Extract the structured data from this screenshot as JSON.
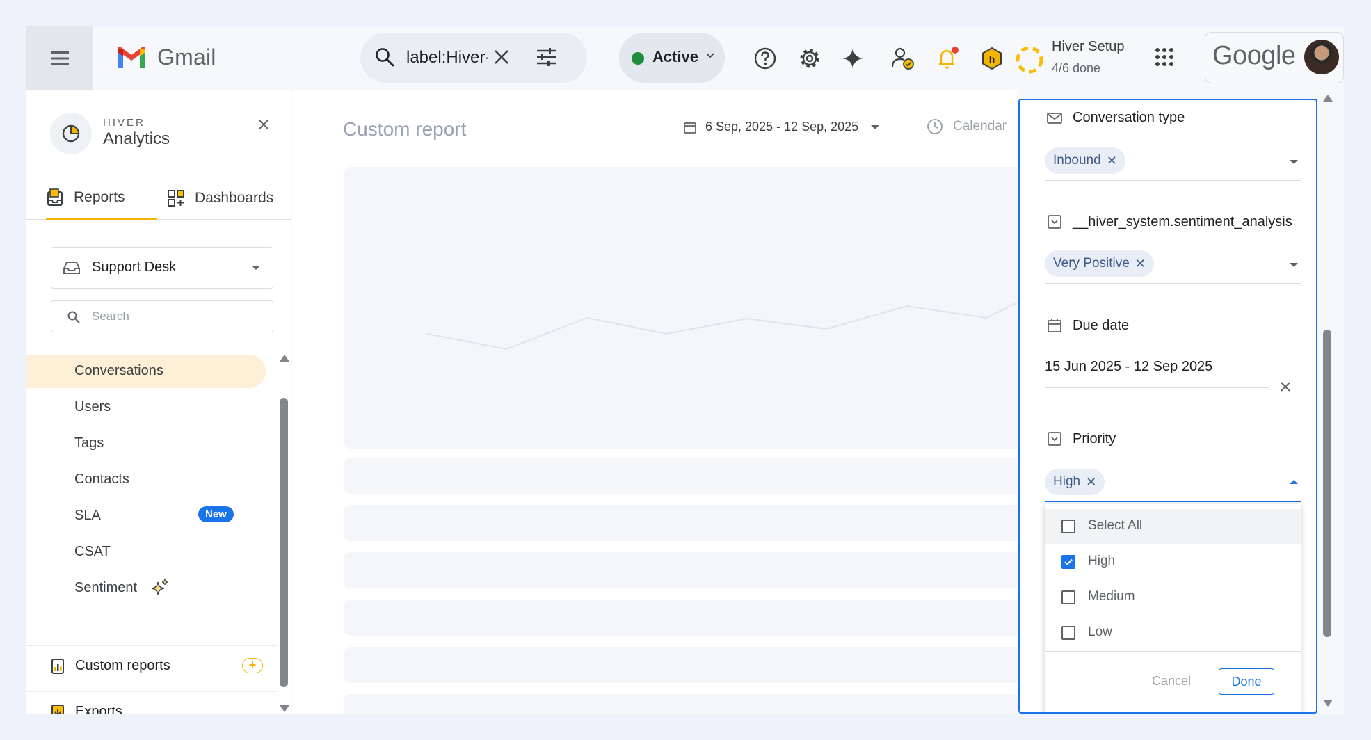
{
  "topbar": {
    "app_name": "Gmail",
    "search_query": "label:Hiver-",
    "status_label": "Active",
    "status_color": "#1e8e3e",
    "hiver_setup_title": "Hiver Setup",
    "hiver_setup_progress": "4/6 done",
    "google_wordmark": "Google"
  },
  "sidebar": {
    "brand_kicker": "HIVER",
    "brand_title": "Analytics",
    "tabs": [
      {
        "label": "Reports",
        "active": true
      },
      {
        "label": "Dashboards",
        "active": false
      }
    ],
    "workspace": "Support Desk",
    "search_placeholder": "Search",
    "nav_items": [
      {
        "label": "Conversations",
        "active": true
      },
      {
        "label": "Users"
      },
      {
        "label": "Tags"
      },
      {
        "label": "Contacts"
      },
      {
        "label": "SLA",
        "badge": "New"
      },
      {
        "label": "CSAT"
      },
      {
        "label": "Sentiment",
        "icon": "sparkle-icon"
      }
    ],
    "custom_reports_label": "Custom reports",
    "exports_label": "Exports",
    "accent_color": "#f4b400"
  },
  "main": {
    "title": "Custom report",
    "date_range": "6 Sep, 2025 - 12 Sep, 2025",
    "calendar_label": "Calendar"
  },
  "filters": {
    "conversation_type": {
      "label": "Conversation type",
      "chips": [
        "Inbound"
      ]
    },
    "sentiment": {
      "label": "__hiver_system.sentiment_analysis",
      "chips": [
        "Very Positive"
      ]
    },
    "due_date": {
      "label": "Due date",
      "value": "15 Jun 2025 - 12 Sep 2025"
    },
    "priority": {
      "label": "Priority",
      "chips": [
        "High"
      ],
      "options": [
        {
          "label": "Select All",
          "checked": false
        },
        {
          "label": "High",
          "checked": true
        },
        {
          "label": "Medium",
          "checked": false
        },
        {
          "label": "Low",
          "checked": false
        }
      ],
      "cancel_label": "Cancel",
      "done_label": "Done"
    }
  }
}
